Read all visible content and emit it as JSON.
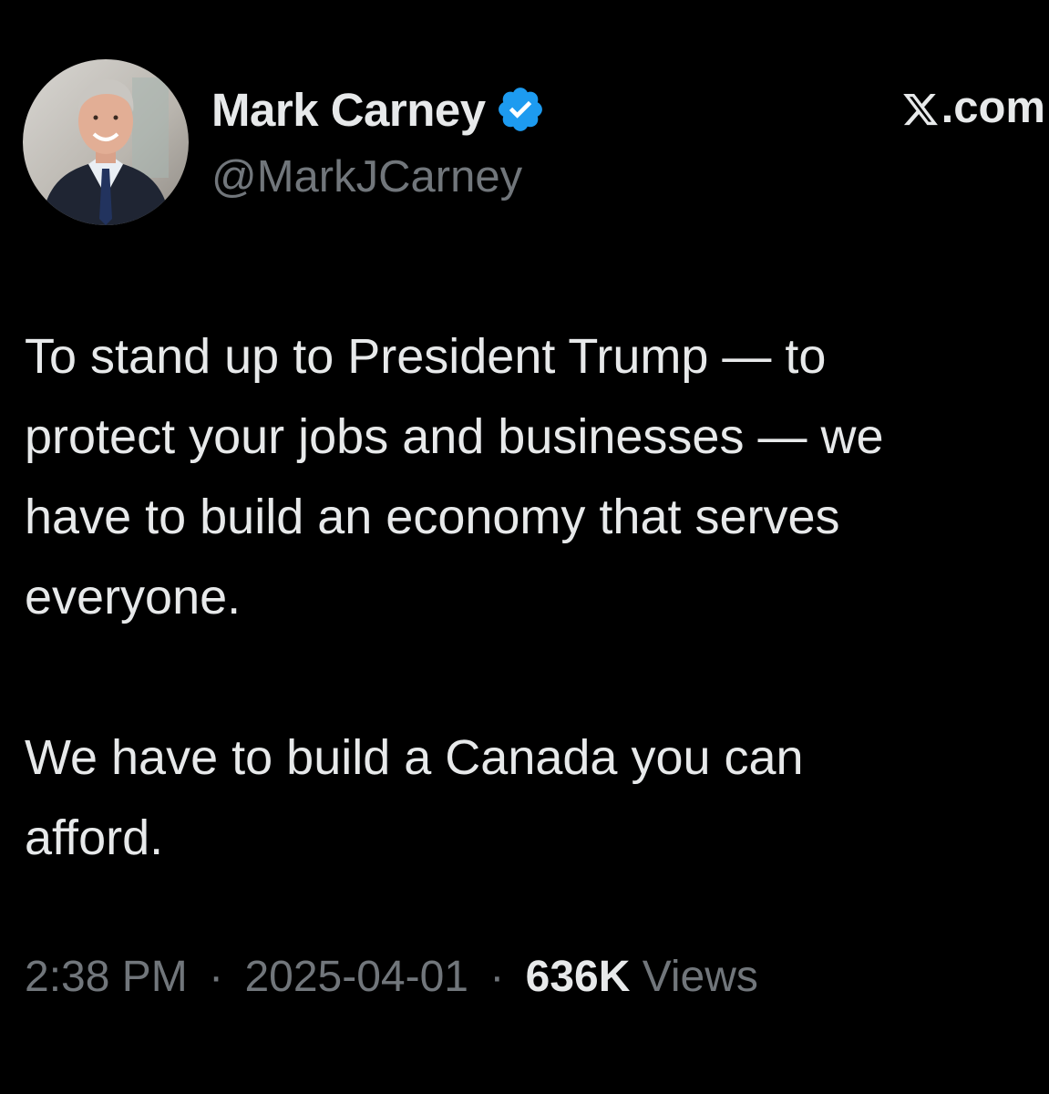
{
  "author": {
    "display_name": "Mark Carney",
    "handle": "@MarkJCarney",
    "verified_icon": "verified-badge-icon",
    "avatar": "profile-photo"
  },
  "site": {
    "logo_icon": "x-logo-icon",
    "label": ".com"
  },
  "tweet": {
    "lines": [
      "To stand up to President Trump — to",
      "protect your jobs and businesses — we",
      "have to build an economy that serves",
      "everyone.",
      "",
      "We have to build a Canada you can",
      "afford."
    ]
  },
  "meta": {
    "time": "2:38 PM",
    "separator": "·",
    "date": "2025-04-01",
    "views_count": "636K",
    "views_label": "Views"
  },
  "colors": {
    "background": "#000000",
    "primary_text": "#e7e9ea",
    "secondary_text": "#71767b",
    "verified_blue": "#1d9bf0"
  }
}
